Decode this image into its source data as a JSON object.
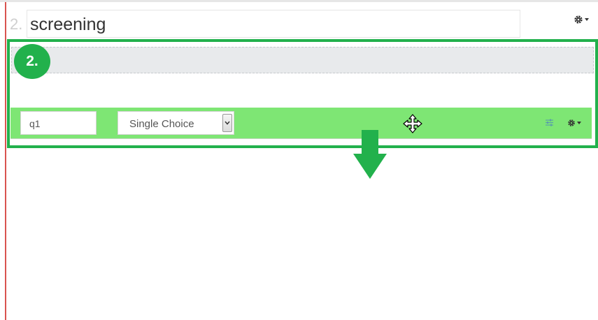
{
  "page": {
    "number": "2.",
    "title": "screening",
    "settings_icon": "gear-icon"
  },
  "step_badge": "2.",
  "question": {
    "name_value": "q1",
    "type_value": "Single Choice",
    "move_icon": "move-icon",
    "sliders_icon": "sliders-icon",
    "settings_icon": "gear-icon"
  },
  "colors": {
    "annotation_green": "#22b14c",
    "question_bar": "#7ee674",
    "dropzone": "#e8eaec",
    "left_rule": "#d9534f"
  }
}
